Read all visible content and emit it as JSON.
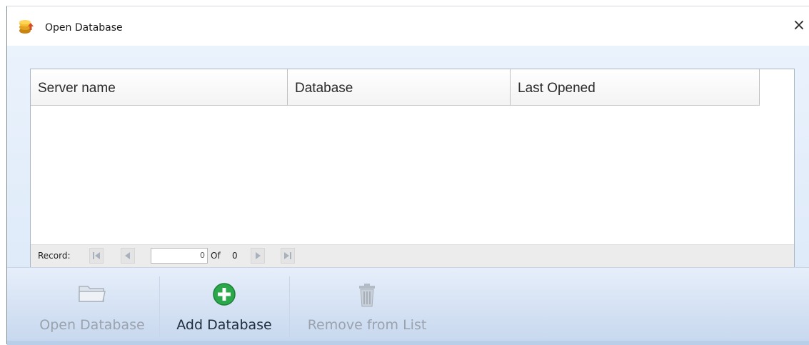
{
  "window": {
    "title": "Open Database",
    "close_glyph": "×",
    "title_icon": "database-stack-icon"
  },
  "grid": {
    "columns": [
      "Server name",
      "Database",
      "Last Opened"
    ],
    "rows": []
  },
  "navigator": {
    "label": "Record:",
    "current": "0",
    "of_label": "Of",
    "total": "0"
  },
  "toolbar": {
    "open_label": "Open Database",
    "add_label": "Add Database",
    "remove_label": "Remove from List",
    "open_icon": "folder-icon",
    "add_icon": "plus-circle-icon",
    "remove_icon": "trash-icon",
    "add_icon_color": "#2aa84a"
  }
}
